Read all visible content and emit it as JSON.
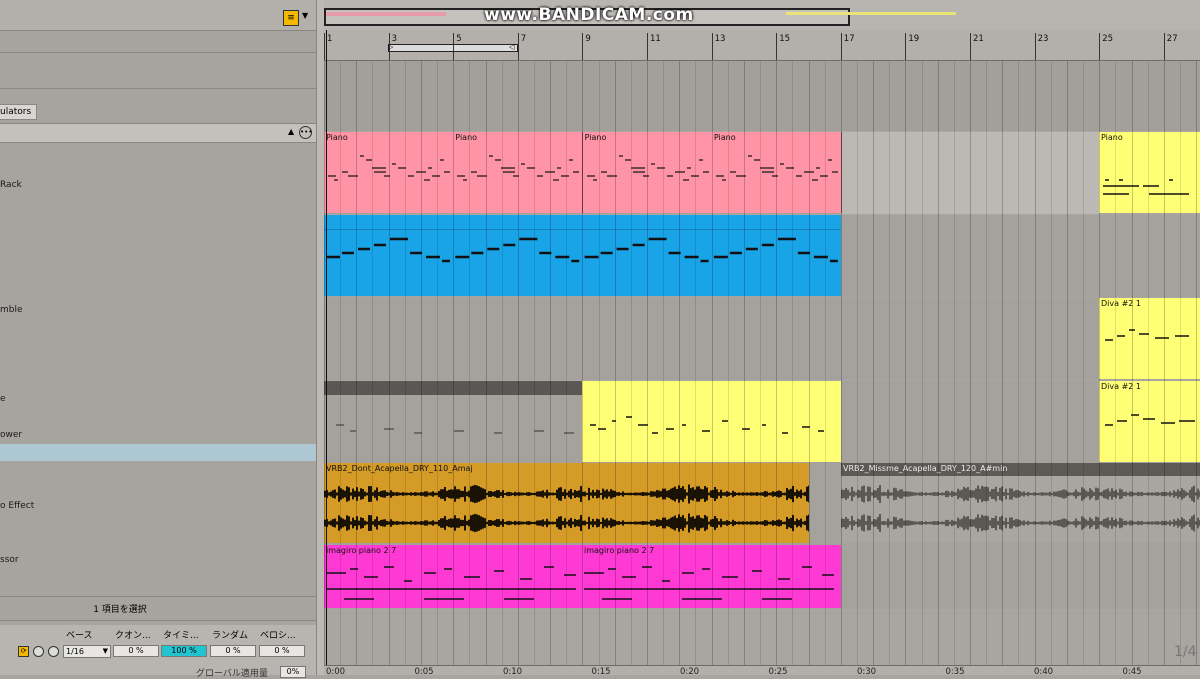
{
  "watermark": "www.BANDICAM.com",
  "left_panel": {
    "modulators_tab": "ulators",
    "items": [
      {
        "label": "Rack"
      },
      {
        "label": "mble"
      },
      {
        "label": "e"
      },
      {
        "label": "ower"
      },
      {
        "label": "o Effect"
      },
      {
        "label": "ssor"
      }
    ],
    "selection_status": "1 項目を選択",
    "quantize": {
      "headers": [
        "ベース",
        "クオン...",
        "タイミ...",
        "ランダム",
        "ベロシ..."
      ],
      "base_value": "1/16",
      "quantize_value": "0 %",
      "timing_value": "100 %",
      "random_value": "0 %",
      "velocity_value": "0 %",
      "global_label": "グローバル適用量",
      "global_value": "0%"
    }
  },
  "ruler": {
    "bars": [
      "1",
      "3",
      "5",
      "7",
      "9",
      "11",
      "13",
      "15",
      "17",
      "19",
      "21",
      "23",
      "25",
      "27"
    ],
    "times": [
      "0:00",
      "0:05",
      "0:10",
      "0:15",
      "0:20",
      "0:25",
      "0:30",
      "0:35",
      "0:40",
      "0:45"
    ]
  },
  "clips": {
    "piano": "Piano",
    "diva": "Diva #2 1",
    "audio1": "VRB2_Dont_Acapella_DRY_110_Amaj",
    "audio2": "VRB2_Missme_Acapella_DRY_120_A#min",
    "imagiro": "imagiro piano 2 7"
  },
  "zoom_label": "1/4",
  "colors": {
    "piano": "#ff94a6",
    "blue": "#1aa4e8",
    "yellow": "#ffff75",
    "audio": "#d49b27",
    "magenta": "#ff39d4",
    "timing_highlight": "#23c4d1",
    "selected_row": "#aec8d3",
    "quantize_icon": "#f5b800"
  }
}
